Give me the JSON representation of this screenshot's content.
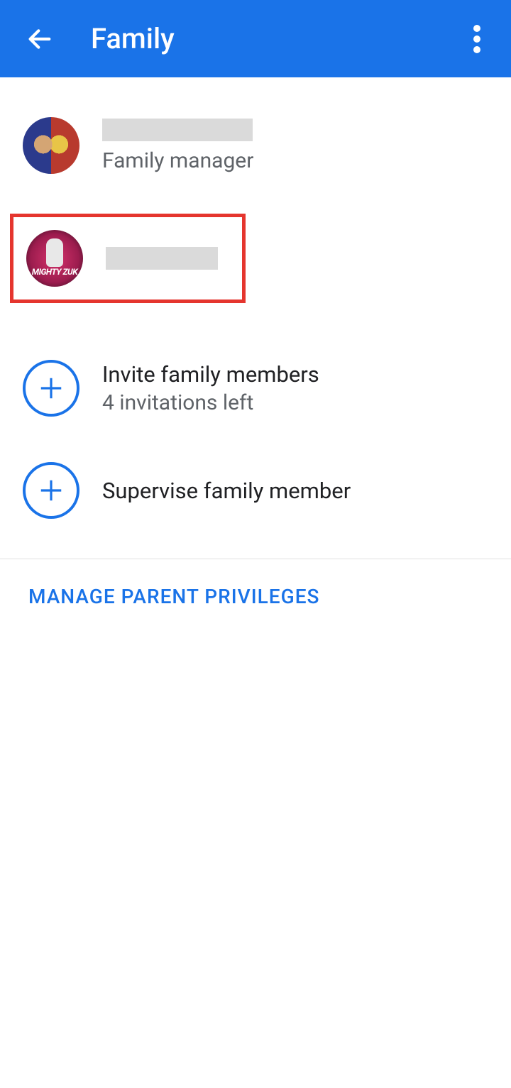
{
  "header": {
    "title": "Family"
  },
  "members": [
    {
      "name_redacted": true,
      "role": "Family manager",
      "avatar_style": "hero"
    },
    {
      "name_redacted": true,
      "avatar_style": "astronaut",
      "avatar_label": "MIGHTY ZUK",
      "highlighted": true
    }
  ],
  "actions": {
    "invite": {
      "title": "Invite family members",
      "subtitle": "4 invitations left"
    },
    "supervise": {
      "title": "Supervise family member"
    }
  },
  "footer": {
    "manage_link": "MANAGE PARENT PRIVILEGES"
  },
  "colors": {
    "primary": "#1a73e8",
    "highlight_border": "#e5352e"
  }
}
